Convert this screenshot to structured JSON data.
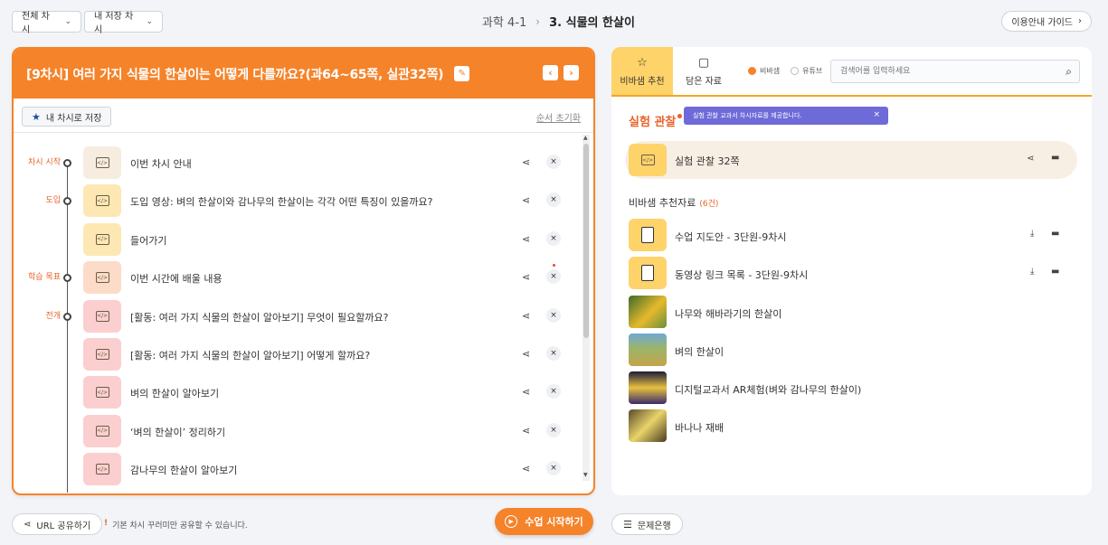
{
  "topbar": {
    "all_lessons": "전체 차시",
    "my_lessons": "내 저장 차시",
    "breadcrumb_subject": "과학 4-1",
    "breadcrumb_unit": "3. 식물의 한살이",
    "guide_label": "이용안내 가이드"
  },
  "left_panel": {
    "title": "[9차시] 여러 가지 식물의 한살이는 어떻게 다를까요?(과64~65쪽, 실관32쪽)",
    "save_label": "내 차시로 저장",
    "reset_label": "순서 초기화",
    "rows": [
      {
        "stage": "차시 시작",
        "label": "이번 차시 안내",
        "color": "#f7ece0"
      },
      {
        "stage": "도입",
        "label": "도입 영상: 벼의 한살이와 감나무의 한살이는 각각 어떤 특징이 있을까요?",
        "color": "#fde8b4"
      },
      {
        "stage": "",
        "label": "들어가기",
        "color": "#fde8b4"
      },
      {
        "stage": "학습 목표",
        "label": "이번 시간에 배울 내용",
        "color": "#fcdcc9"
      },
      {
        "stage": "전개",
        "label": "[활동: 여러 가지 식물의 한살이 알아보기] 무엇이 필요할까요?",
        "color": "#fbcfcf"
      },
      {
        "stage": "",
        "label": "[활동: 여러 가지 식물의 한살이 알아보기] 어떻게 할까요?",
        "color": "#fbcfcf"
      },
      {
        "stage": "",
        "label": "벼의 한살이 알아보기",
        "color": "#fbcfcf"
      },
      {
        "stage": "",
        "label": "‘벼의 한살이’ 정리하기",
        "color": "#fbcfcf"
      },
      {
        "stage": "",
        "label": "감나무의 한살이 알아보기",
        "color": "#fbcfcf"
      }
    ]
  },
  "right_panel": {
    "tab_recommend": "비바샘 추천",
    "tab_saved": "담은 자료",
    "radio_vivasam": "비바샘",
    "radio_youtube": "유튜브",
    "search_placeholder": "검색어를 입력하세요",
    "section_title": "실험 관찰",
    "tooltip": "실험 관찰 교과서 차시자료를 제공합니다.",
    "experiment_item": "실험 관찰 32쪽",
    "rec_title": "비바샘 추천자료",
    "rec_count": "(6건)",
    "files": [
      "수업 지도안 - 3단원-9차시",
      "동영상 링크 목록 - 3단원-9차시"
    ],
    "videos": [
      "나무와 해바라기의 한살이",
      "벼의 한살이",
      "디지털교과서 AR체험(벼와 감나무의 한살이)",
      "바나나 재배"
    ]
  },
  "bottom": {
    "url_share": "URL 공유하기",
    "notice": "기본 차시 꾸러미만 공유할 수 있습니다.",
    "start": "수업 시작하기",
    "question_bank": "문제은행"
  }
}
